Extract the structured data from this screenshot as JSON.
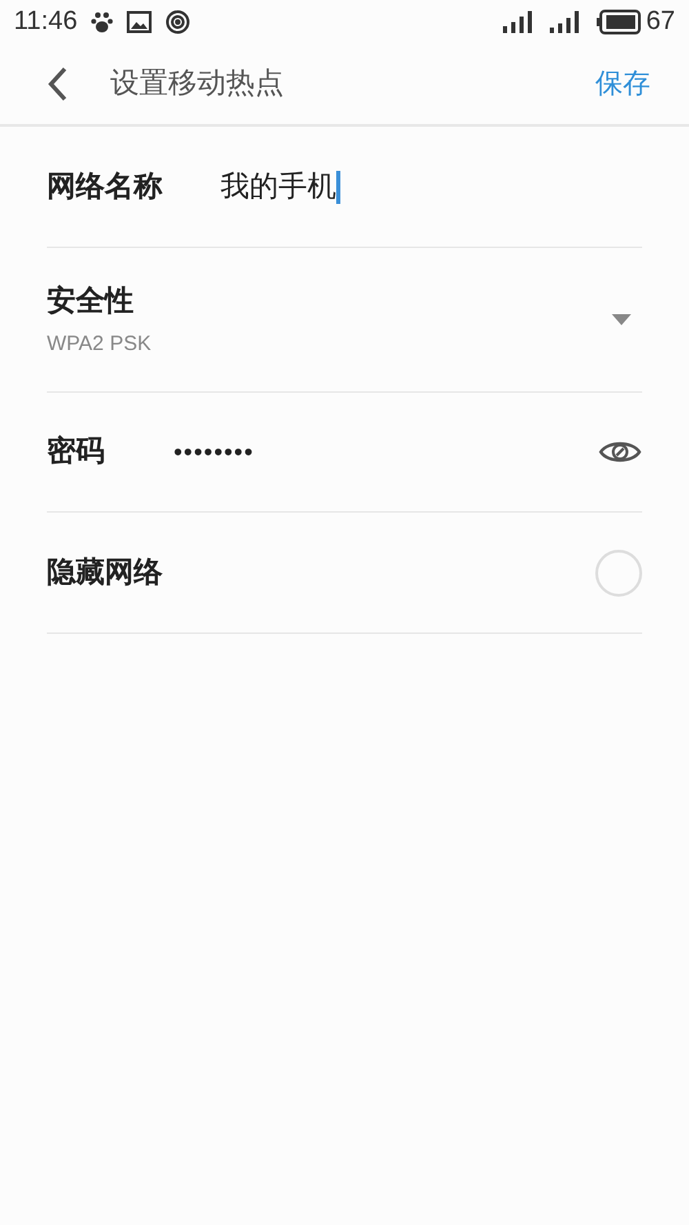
{
  "status_bar": {
    "time": "11:46",
    "battery": "67"
  },
  "header": {
    "title": "设置移动热点",
    "action": "保存"
  },
  "rows": [
    {
      "kind": "text",
      "label": "网络名称",
      "value": "我的手机",
      "focused": true
    },
    {
      "kind": "select",
      "label": "安全性",
      "value": "WPA2 PSK"
    },
    {
      "kind": "password",
      "label": "密码",
      "value": "••••••••"
    },
    {
      "kind": "check",
      "label": "隐藏网络",
      "checked": false
    }
  ]
}
